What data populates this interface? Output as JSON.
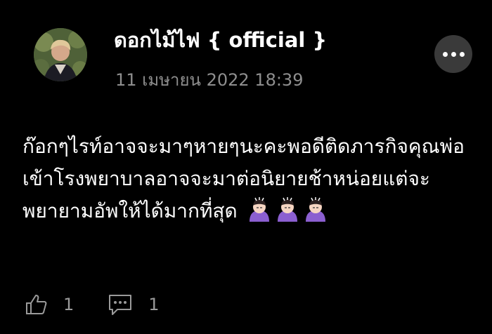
{
  "post": {
    "author": "ดอกไม้ไฟ { official }",
    "timestamp": "11 เมษายน 2022 18:39",
    "body": "ก๊อกๆไรท์อาจจะมาๆหายๆนะคะพอดีติดภารกิจคุณพ่อเข้าโรงพยาบาลอาจจะมาต่อนิยายช้าหน่อยแต่จะพยายามอัพให้ได้มากที่สุด",
    "emojis": [
      "woman-bowing-emoji",
      "woman-bowing-emoji",
      "woman-bowing-emoji"
    ]
  },
  "actions": {
    "like_count": "1",
    "comment_count": "1",
    "like_icon": "thumbs-up-icon",
    "comment_icon": "comment-icon",
    "more_icon": "more-horizontal-icon"
  },
  "colors": {
    "background": "#000000",
    "text": "#ffffff",
    "muted": "#8e8e8e",
    "button": "#3a3a3a"
  }
}
